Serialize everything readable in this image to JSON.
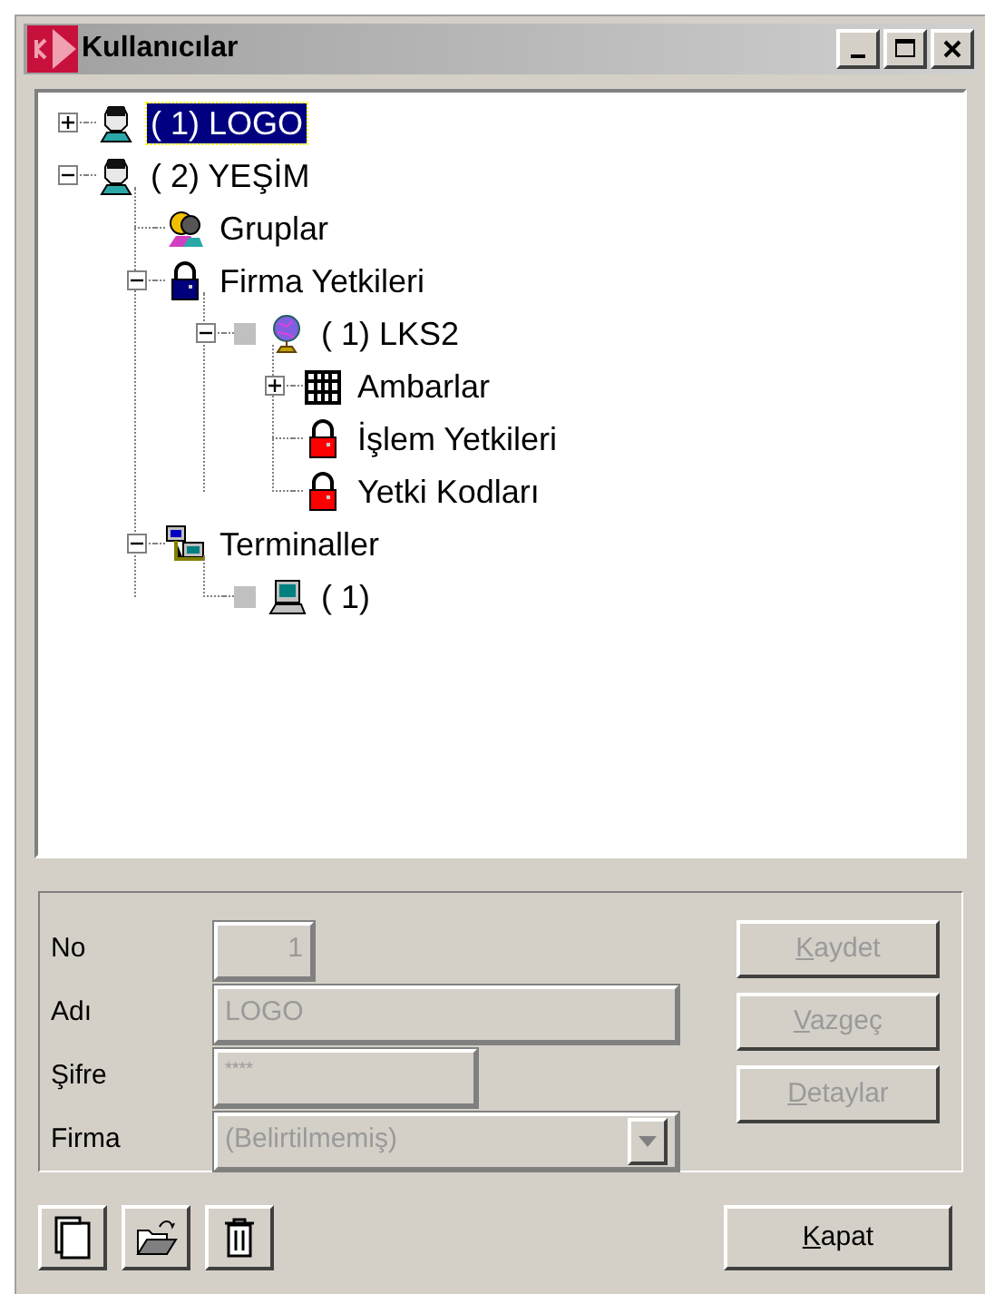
{
  "window": {
    "title": "Kullanıcılar",
    "controls": [
      {
        "kind": "minimize"
      },
      {
        "kind": "maximize"
      },
      {
        "kind": "close"
      }
    ]
  },
  "tree": [
    {
      "label": "( 1) LOGO",
      "kind": "user",
      "expanded": false,
      "selected": true,
      "flag": false
    },
    {
      "label": "( 2) YEŞİM",
      "kind": "user",
      "expanded": true,
      "selected": false,
      "flag": false,
      "children": [
        {
          "label": "Gruplar",
          "kind": "group",
          "selected": false,
          "flag": false
        },
        {
          "label": "Firma Yetkileri",
          "kind": "lock-blue",
          "expanded": true,
          "selected": false,
          "flag": false,
          "children": [
            {
              "label": "(  1) LKS2",
              "kind": "globe",
              "expanded": true,
              "selected": false,
              "flag": true,
              "children": [
                {
                  "label": "Ambarlar",
                  "kind": "warehouse",
                  "expanded": false,
                  "selected": false,
                  "flag": false
                },
                {
                  "label": "İşlem Yetkileri",
                  "kind": "lock-red",
                  "selected": false,
                  "flag": false
                },
                {
                  "label": "Yetki Kodları",
                  "kind": "lock-red",
                  "selected": false,
                  "flag": false
                }
              ]
            }
          ]
        },
        {
          "label": "Terminaller",
          "kind": "network",
          "expanded": true,
          "selected": false,
          "flag": false,
          "children": [
            {
              "label": "( 1)",
              "kind": "terminal",
              "selected": false,
              "flag": true
            }
          ]
        }
      ]
    }
  ],
  "form": {
    "fields": [
      {
        "label": "No",
        "value": "1",
        "kind": "short",
        "disabled": true
      },
      {
        "label": "Adı",
        "value": "LOGO",
        "kind": "long",
        "disabled": true
      },
      {
        "label": "Şifre",
        "value": "****",
        "kind": "medium",
        "disabled": true
      },
      {
        "label": "Firma",
        "value": "(Belirtilmemiş)",
        "kind": "combo",
        "disabled": true
      }
    ],
    "buttons": [
      {
        "label": "Kaydet",
        "disabled": true
      },
      {
        "label": "Vazgeç",
        "disabled": true
      },
      {
        "label": "Detaylar",
        "disabled": true
      }
    ]
  },
  "toolbar": [
    {
      "kind": "new"
    },
    {
      "kind": "open"
    },
    {
      "kind": "delete"
    }
  ],
  "close_button": {
    "label": "Kapat",
    "disabled": false
  }
}
